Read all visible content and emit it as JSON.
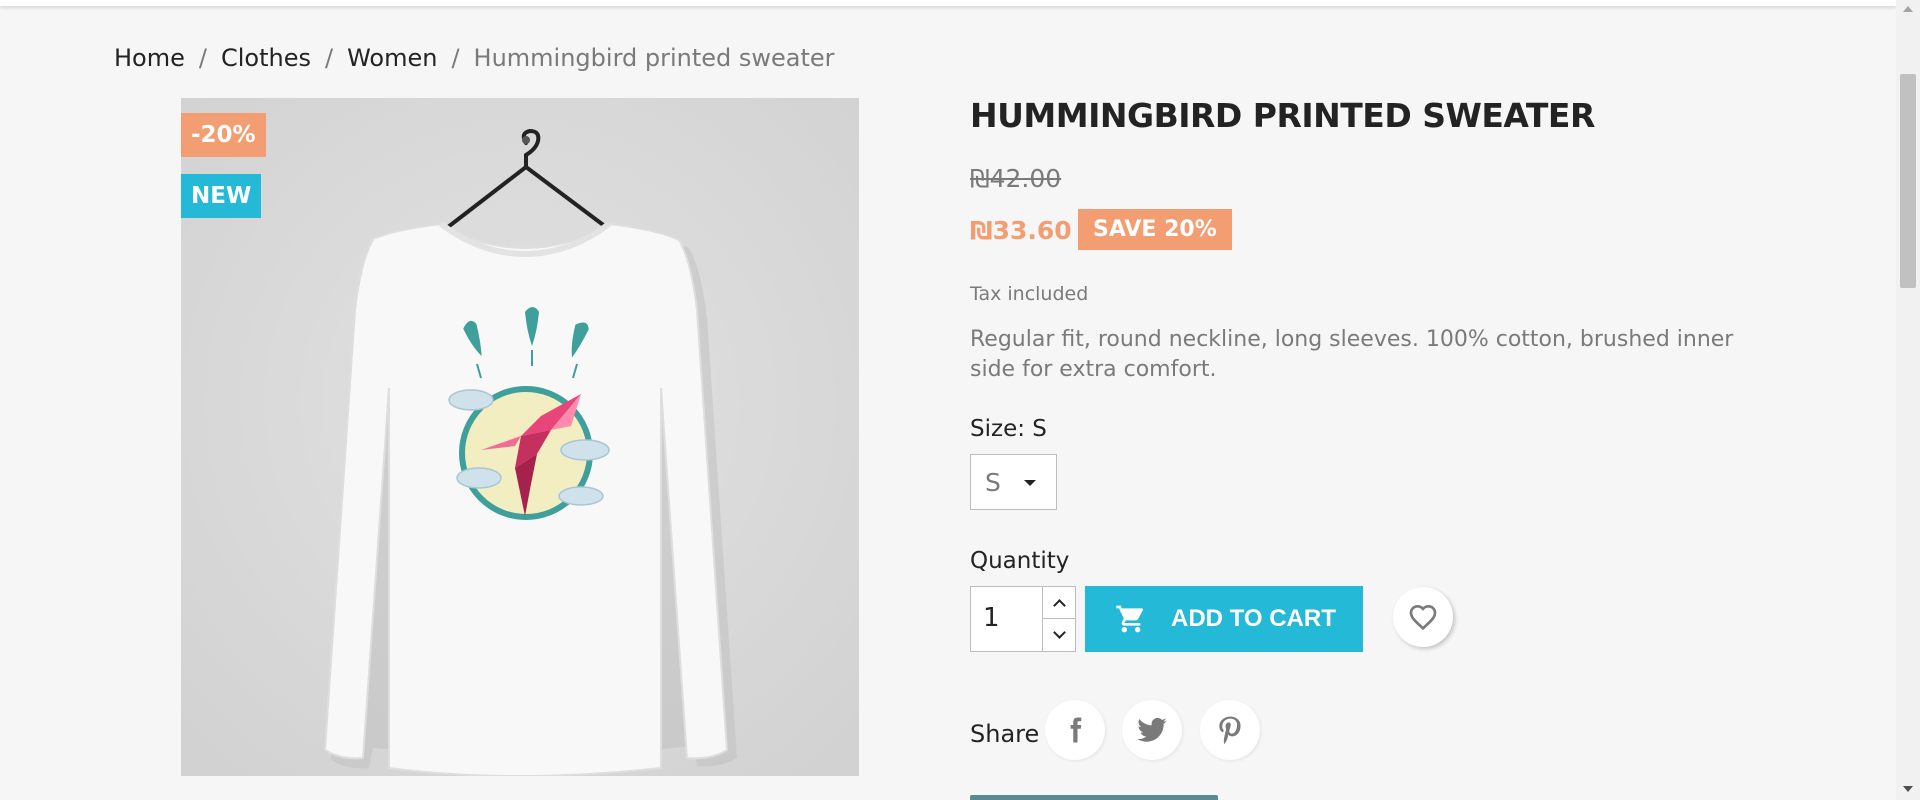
{
  "breadcrumb": {
    "items": [
      "Home",
      "Clothes",
      "Women"
    ],
    "separator": "/",
    "current": "Hummingbird printed sweater"
  },
  "badges": {
    "discount": "-20%",
    "new": "NEW"
  },
  "product": {
    "title": "HUMMINGBIRD PRINTED SWEATER",
    "old_price": "₪42.00",
    "price": "₪33.60",
    "save_label": "SAVE 20%",
    "tax_note": "Tax included",
    "description": "Regular fit, round neckline, long sleeves. 100% cotton, brushed inner side for extra comfort."
  },
  "size": {
    "label": "Size: S",
    "selected": "S"
  },
  "quantity": {
    "label": "Quantity",
    "value": "1"
  },
  "cart": {
    "button_label": "ADD TO CART",
    "icon": "shopping-cart-icon"
  },
  "wishlist": {
    "icon": "heart-icon"
  },
  "share": {
    "label": "Share",
    "networks": [
      "facebook-icon",
      "twitter-icon",
      "pinterest-icon"
    ]
  },
  "colors": {
    "accent": "#24b9d7",
    "discount": "#f39d72",
    "background": "#f6f6f6",
    "text": "#232323",
    "muted": "#7a7a7a"
  }
}
